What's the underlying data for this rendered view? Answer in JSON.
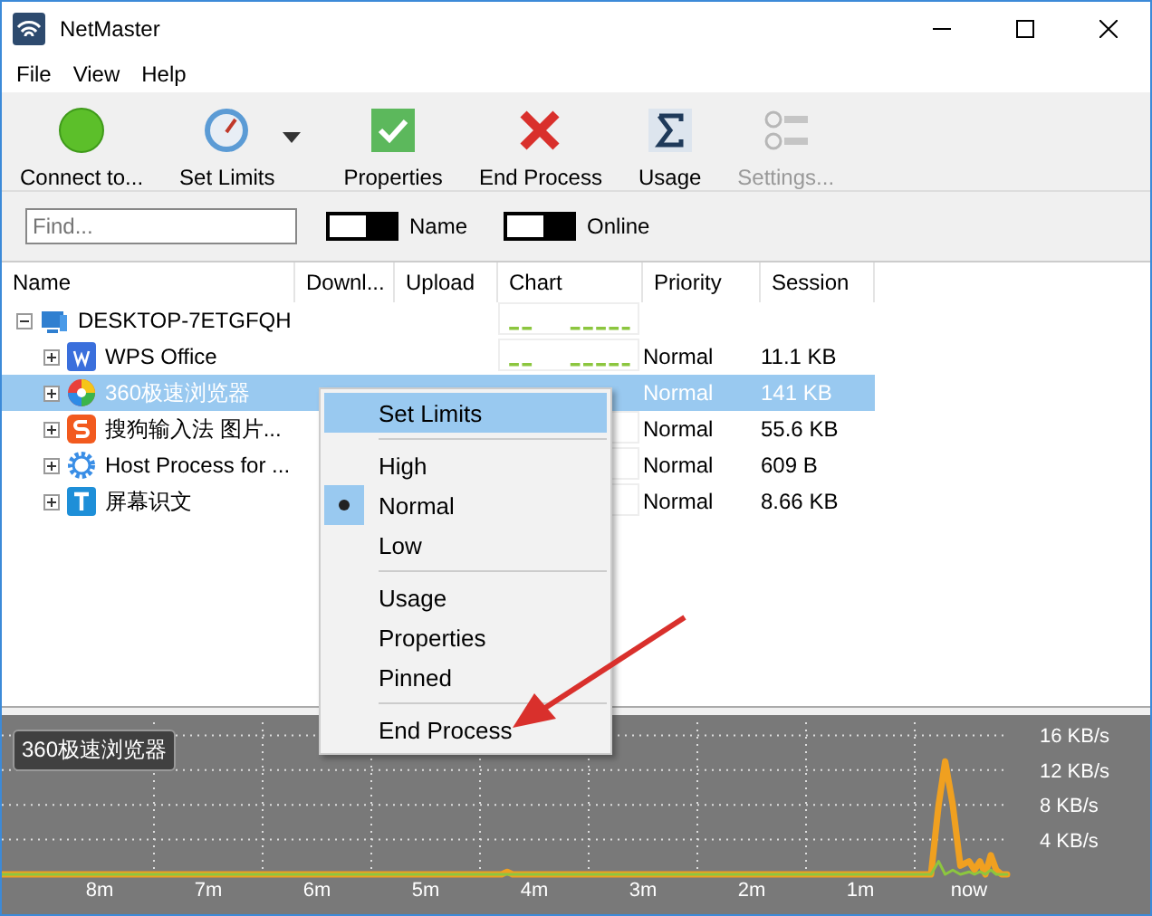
{
  "window": {
    "title": "NetMaster"
  },
  "menu_bar": [
    "File",
    "View",
    "Help"
  ],
  "toolbar": [
    {
      "label": "Connect to...",
      "disabled": false,
      "dropdown": false
    },
    {
      "label": "Set Limits",
      "disabled": false,
      "dropdown": true
    },
    {
      "label": "Properties",
      "disabled": false,
      "dropdown": false
    },
    {
      "label": "End Process",
      "disabled": false,
      "dropdown": false
    },
    {
      "label": "Usage",
      "disabled": false,
      "dropdown": false
    },
    {
      "label": "Settings...",
      "disabled": true,
      "dropdown": false
    }
  ],
  "filter": {
    "placeholder": "Find...",
    "toggles": [
      {
        "label": "Name",
        "on": true
      },
      {
        "label": "Online",
        "on": true
      }
    ]
  },
  "table": {
    "columns": [
      "Name",
      "Downl...",
      "Upload",
      "Chart",
      "Priority",
      "Session"
    ],
    "rows": [
      {
        "name": "DESKTOP-7ETGFQH",
        "expanded": true,
        "selected": false,
        "activity": true,
        "children": [
          {
            "name": "WPS Office",
            "expanded": false,
            "selected": false,
            "activity": true,
            "priority": "Normal",
            "session": "11.1 KB"
          },
          {
            "name": "360极速浏览器",
            "expanded": false,
            "selected": true,
            "priority": "Normal",
            "session": "141 KB"
          },
          {
            "name": "搜狗输入法 图片...",
            "expanded": false,
            "selected": false,
            "activity": false,
            "priority": "Normal",
            "session": "55.6 KB"
          },
          {
            "name": "Host Process for ...",
            "expanded": false,
            "selected": false,
            "activity": false,
            "priority": "Normal",
            "session": "609 B"
          },
          {
            "name": "屏幕识文",
            "expanded": false,
            "selected": false,
            "activity": false,
            "priority": "Normal",
            "session": "8.66 KB"
          }
        ]
      }
    ]
  },
  "context_menu": {
    "groups": [
      {
        "items": [
          {
            "label": "Set Limits",
            "highlighted": true,
            "checked": false
          }
        ]
      },
      {
        "items": [
          {
            "label": "High",
            "highlighted": false,
            "checked": false
          },
          {
            "label": "Normal",
            "highlighted": false,
            "checked": true
          },
          {
            "label": "Low",
            "highlighted": false,
            "checked": false
          }
        ]
      },
      {
        "items": [
          {
            "label": "Usage",
            "highlighted": false,
            "checked": false
          },
          {
            "label": "Properties",
            "highlighted": false,
            "checked": false
          },
          {
            "label": "Pinned",
            "highlighted": false,
            "checked": false
          }
        ]
      },
      {
        "items": [
          {
            "label": "End Process",
            "highlighted": false,
            "checked": false
          }
        ]
      }
    ]
  },
  "graph": {
    "caption": "360极速浏览器",
    "chart_data": {
      "type": "line",
      "x": [
        8.9,
        4.3,
        4.25,
        4.2,
        0.5,
        0.35,
        0.28,
        0.22,
        0.15,
        0.08,
        0,
        -0.05,
        -0.1,
        -0.15,
        -0.2,
        -0.25,
        -0.3,
        -0.35
      ],
      "series": [
        {
          "color": "#f0a020",
          "values": [
            0,
            0,
            0.3,
            0,
            0,
            0,
            8,
            13,
            8,
            1,
            1.5,
            0.5,
            1.5,
            0,
            2.2,
            0.5,
            0,
            0
          ]
        },
        {
          "color": "#8cc63f",
          "values": [
            0,
            0,
            0,
            0,
            0,
            0,
            1.5,
            0,
            0.5,
            0,
            0.3,
            0,
            0.3,
            0,
            0.5,
            0,
            0,
            0
          ]
        }
      ],
      "grid": true,
      "xlim": [
        8.9,
        -0.35
      ],
      "ylim": [
        0,
        17.5
      ],
      "xticks": [
        {
          "value": 8,
          "label": "8m"
        },
        {
          "value": 7,
          "label": "7m"
        },
        {
          "value": 6,
          "label": "6m"
        },
        {
          "value": 5,
          "label": "5m"
        },
        {
          "value": 4,
          "label": "4m"
        },
        {
          "value": 3,
          "label": "3m"
        },
        {
          "value": 2,
          "label": "2m"
        },
        {
          "value": 1,
          "label": "1m"
        },
        {
          "value": 0,
          "label": "now"
        }
      ],
      "yticks": [
        {
          "value": 4,
          "label": "4 KB/s"
        },
        {
          "value": 8,
          "label": "8 KB/s"
        },
        {
          "value": 12,
          "label": "12 KB/s"
        },
        {
          "value": 16,
          "label": "16 KB/s"
        }
      ]
    }
  }
}
